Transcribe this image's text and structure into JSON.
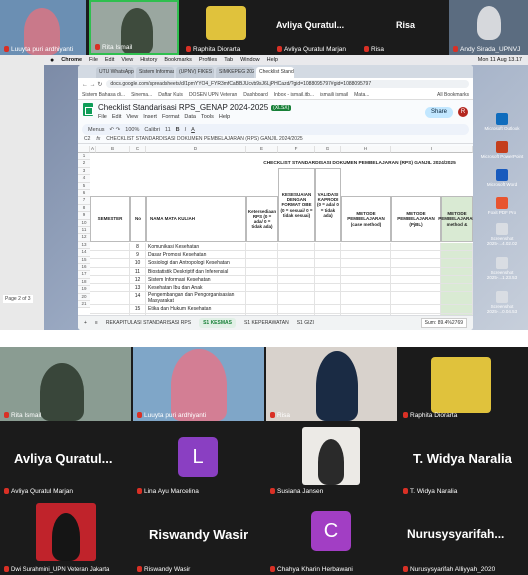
{
  "top_meeting": {
    "participants": [
      {
        "name": "Luuyta puri ardhiyanti"
      },
      {
        "name": "Rita Ismail"
      },
      {
        "name": "Raphita Diorarta"
      },
      {
        "name": "Avliya Quratul Marjan",
        "display": "Avliya  Quratul..."
      },
      {
        "name": "Risa",
        "display": "Risa"
      },
      {
        "name": "Andy Sirada_UPNVJ"
      }
    ]
  },
  "mac": {
    "menubar": [
      "Chrome",
      "File",
      "Edit",
      "View",
      "History",
      "Bookmarks",
      "Profiles",
      "Tab",
      "Window",
      "Help"
    ],
    "clock": "Mon 11 Aug 13.17"
  },
  "browser": {
    "tabs": [
      "UTU WhatsApp",
      "Sistem Informasi Proc",
      "(UPNV) FIKES Bahan",
      "SIMKEPEG 2025 - Ne",
      "Checklist Standarisasi"
    ],
    "url": "docs.google.com/spreadsheets/d/1pmYYO4_FYR3mfCaBBJUcvb9sJ6LjPHCazd/?gid=1088095797#gid=1088095797",
    "bookmarks": [
      "Sistem Bahasa di...",
      "Sinema...",
      "Daftar Kuis",
      "DOSEN UPN Veteran",
      "Dashboard",
      "Inbox - ismail.itb...",
      "ismaili ismail",
      "Mata...",
      "All Bookmarks"
    ]
  },
  "sheet": {
    "title": "Checklist Standarisasi RPS_GENAP 2024-2025",
    "badge": "(XLSX)",
    "menu": [
      "File",
      "Edit",
      "View",
      "Insert",
      "Format",
      "Data",
      "Tools",
      "Help"
    ],
    "share": "Share",
    "avatar": "R",
    "toolbar": [
      "Menus",
      "100%",
      "Calibri",
      "11",
      "B",
      "I",
      "A"
    ],
    "cell_ref": "C2",
    "formula": "CHECKLIST STANDARDISASI DOKUMEN PEMBELAJARAN (RPS) GANJIL 2024/2025",
    "banner": "CHECKLIST STANDARDISASI DOKUMEN PEMBELAJARAN (RPS) GANJIL 2024/2025",
    "columns": [
      "A",
      "B",
      "C",
      "D",
      "E",
      "F",
      "G",
      "H",
      "I"
    ],
    "headers": {
      "semester": "SEMESTER",
      "no": "No",
      "nama": "NAMA MATA KULIAH",
      "ketersediaan": "Ketersediaan RPS (0 = ada/ 0 = tidak ada)",
      "kesesuaian": "KESESUAIAN DENGAN FORMAT OBE (0 = sesuai/ 0 = tidak sesuai)",
      "validasi": "VALIDASI KAPRODI (0 = ada/ 0 = tidak ada)",
      "metode_cm": "METODE PEMBELAJARAN (case method)",
      "metode_pbl": "METODE PEMBELAJARAN (PjBL)",
      "metode_h": "METODE PEMBELAJARAN method &"
    },
    "row_numbers": [
      "1",
      "2",
      "3",
      "4",
      "5",
      "6",
      "7",
      "8",
      "9",
      "10",
      "11",
      "12",
      "13",
      "14",
      "15",
      "16",
      "17",
      "18",
      "19",
      "20",
      "21"
    ],
    "rows": [
      {
        "no": "8",
        "name": "Komunikasi Kesehatan"
      },
      {
        "no": "9",
        "name": "Dasar Promosi Kesehatan"
      },
      {
        "no": "10",
        "name": "Sosiologi dan Antropologi Kesehatan"
      },
      {
        "no": "11",
        "name": "Biostatistik Deskriptif dan Inferensial"
      },
      {
        "no": "12",
        "name": "Sistem Informasi Kesehatan"
      },
      {
        "no": "13",
        "name": "Kesehatan Ibu dan Anak"
      },
      {
        "no": "14",
        "name": "Pengembangan dan Pengorganisasian Masyarakat"
      },
      {
        "no": "15",
        "name": "Etika dan Hukum Kesehatan"
      },
      {
        "no": "16",
        "name": "Filsafat Ilmu dan Logika"
      }
    ],
    "tabs": [
      "+",
      "≡",
      "REKAPITULASI STANDARISASI RPS",
      "S1 KESMAS",
      "S1 KEPERAWATAN",
      "S1 GIZI"
    ],
    "sum": "Sum: 89.4%2769"
  },
  "dock": [
    "Microsoft Outlook",
    "Microsoft PowerPoint",
    "Microsoft Word",
    "Foxit PDF Pro",
    "Screenshot 2025-...4.02.02",
    "Screenshot 2025-...1.23.53",
    "Screenshot 2025-...0.04.53"
  ],
  "page_left": "Page 2 of 3",
  "bottom_meeting": {
    "tiles": [
      {
        "label": "Rita Ismail"
      },
      {
        "label": "Luuyta puri ardhiyanti"
      },
      {
        "label": "Risa"
      },
      {
        "label": "Raphita Diorarta"
      },
      {
        "big": "Avliya  Quratul...",
        "label": "Avliya Quratul Marjan"
      },
      {
        "avatar": "L",
        "label": "Lina Ayu Marcelina"
      },
      {
        "label": "Susiana Jansen"
      },
      {
        "big": "T. Widya Naralia",
        "label": "T. Widya Naralia"
      },
      {
        "label": "Dwi Surahmini_UPN Veteran Jakarta"
      },
      {
        "big": "Riswandy Wasir",
        "label": "Riswandy Wasir"
      },
      {
        "avatar": "C",
        "label": "Chahya Kharin Herbawani"
      },
      {
        "big": "Nurusysyarifah...",
        "label": "Nurusysyarifah Alliyyah_2020"
      }
    ]
  },
  "colors": {
    "mute": "#d93025",
    "sheets_green": "#0f9d58",
    "avatar_l": "#8a3fc2",
    "avatar_c": "#a23ec4"
  }
}
